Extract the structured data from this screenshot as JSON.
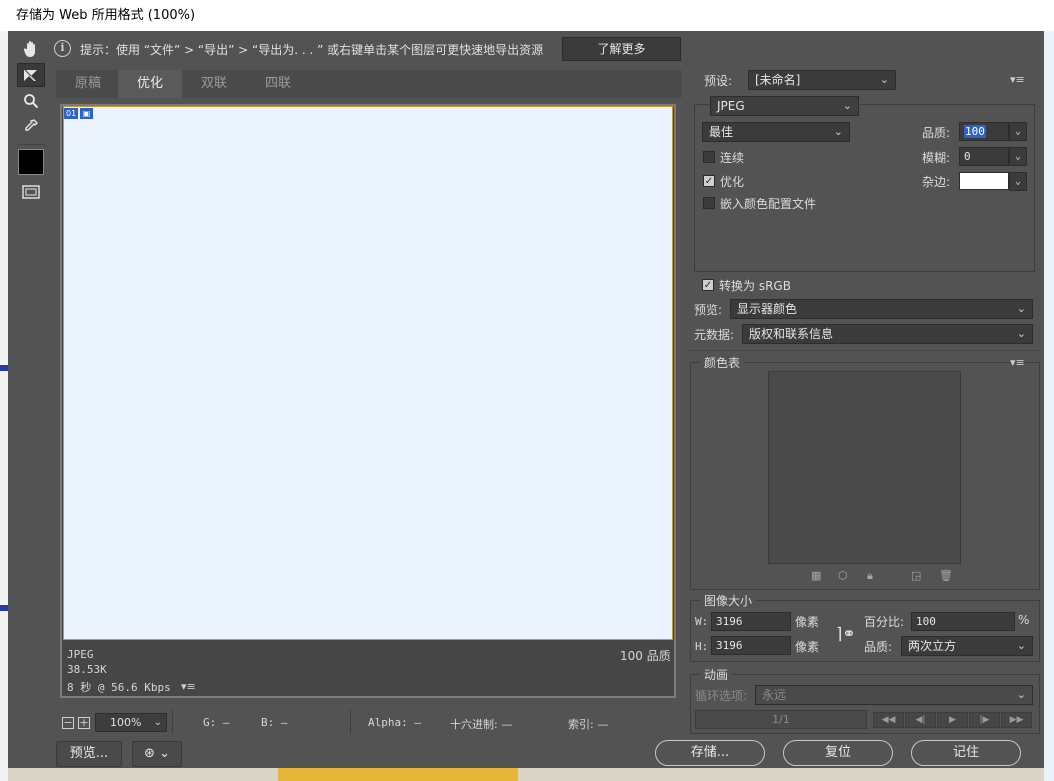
{
  "window": {
    "title": "存储为 Web 所用格式 (100%)"
  },
  "tips": {
    "text": "提示：使用 “文件” > “导出” > “导出为. . . ” 或右键单击某个图层可更快速地导出资源",
    "learn_more": "了解更多"
  },
  "toolbar": {
    "tools": [
      {
        "name": "hand-tool",
        "glyph": "✋"
      },
      {
        "name": "slice-select-tool",
        "glyph": "⬊"
      },
      {
        "name": "zoom-tool",
        "glyph": "🔍"
      },
      {
        "name": "eyedropper-tool",
        "glyph": "✒"
      },
      {
        "name": "toggle-slices-visibility",
        "glyph": "▭"
      }
    ],
    "swatch_color": "#000000"
  },
  "tabs": [
    "原稿",
    "优化",
    "双联",
    "四联"
  ],
  "active_tab": "优化",
  "canvas": {
    "slice_number": "01",
    "background": "#ebf3fe",
    "format": "JPEG",
    "size": "38.53K",
    "download_time": "8 秒 @ 56.6 Kbps",
    "quality_text": "100 品质"
  },
  "status_bar": {
    "zoom": "100%",
    "g_label": "G:",
    "g_value": "—",
    "b_label": "B:",
    "b_value": "—",
    "alpha_label": "Alpha:",
    "alpha_value": "—",
    "hex_label": "十六进制:",
    "hex_value": "—",
    "index_label": "索引:",
    "index_value": "—"
  },
  "footer": {
    "preview_button": "预览...",
    "save_button": "存储...",
    "reset_button": "复位",
    "remember_button": "记住"
  },
  "settings": {
    "preset_label": "预设:",
    "preset_value": "[未命名]",
    "format": "JPEG",
    "quality_preset": "最佳",
    "quality_label": "品质:",
    "quality_value": "100",
    "progressive_label": "连续",
    "progressive_checked": false,
    "optimized_label": "优化",
    "optimized_checked": true,
    "blur_label": "模糊:",
    "blur_value": "0",
    "embed_profile_label": "嵌入颜色配置文件",
    "embed_profile_checked": false,
    "matte_label": "杂边:",
    "matte_color": "#ffffff",
    "convert_srgb_label": "转换为 sRGB",
    "convert_srgb_checked": true,
    "preview_label": "预览:",
    "preview_value": "显示器颜色",
    "metadata_label": "元数据:",
    "metadata_value": "版权和联系信息"
  },
  "color_table": {
    "title": "颜色表"
  },
  "image_size": {
    "title": "图像大小",
    "w_label": "W:",
    "w_value": "3196",
    "h_label": "H:",
    "h_value": "3196",
    "unit": "像素",
    "percent_label": "百分比:",
    "percent_value": "100",
    "percent_unit": "%",
    "quality_label": "品质:",
    "quality_value": "两次立方"
  },
  "animation": {
    "title": "动画",
    "loop_label": "循环选项:",
    "loop_value": "永远",
    "frame_counter": "1/1"
  }
}
